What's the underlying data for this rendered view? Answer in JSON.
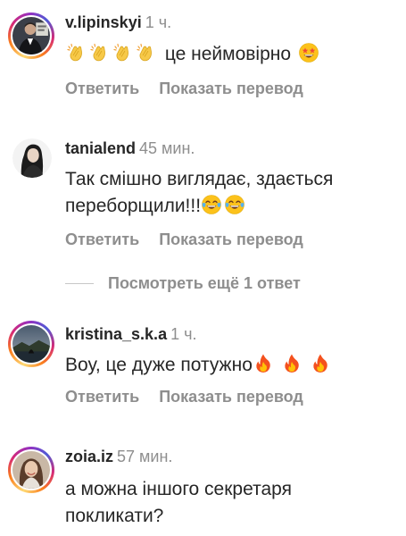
{
  "comments": [
    {
      "username": "v.lipinskyi",
      "time": "1 ч.",
      "text": "це неймовірно",
      "has_story_ring": true,
      "avatar_icon": "user-avatar-man-suit",
      "leading_emoji": [
        "clapping-hands-icon",
        "clapping-hands-icon",
        "clapping-hands-icon",
        "clapping-hands-icon"
      ],
      "trailing_emoji": [
        "star-struck-face-icon"
      ]
    },
    {
      "username": "tanialend",
      "time": "45 мин.",
      "text": "Так смішно виглядає, здається переборщили!!!",
      "has_story_ring": false,
      "avatar_icon": "user-avatar-woman-dark-hair",
      "trailing_emoji": [
        "tears-of-joy-face-icon",
        "tears-of-joy-face-icon"
      ]
    },
    {
      "username": "kristina_s.k.a",
      "time": "1 ч.",
      "text": "Воу, це дуже потужно",
      "has_story_ring": true,
      "avatar_icon": "user-avatar-landscape",
      "trailing_emoji": [
        "fire-icon",
        "fire-icon",
        "fire-icon"
      ]
    },
    {
      "username": "zoia.iz",
      "time": "57 мин.",
      "text": "а можна іншого секретаря покликати?",
      "has_story_ring": true,
      "avatar_icon": "user-avatar-woman-smiling"
    }
  ],
  "actions": {
    "reply": "Ответить",
    "translate": "Показать перевод"
  },
  "view_replies": "Посмотреть ещё 1 ответ",
  "colors": {
    "text": "#262626",
    "secondary": "#8e8e8e",
    "divider": "#c7c7c7",
    "story_ring_start": "#feda75",
    "story_ring_end": "#d62976"
  }
}
